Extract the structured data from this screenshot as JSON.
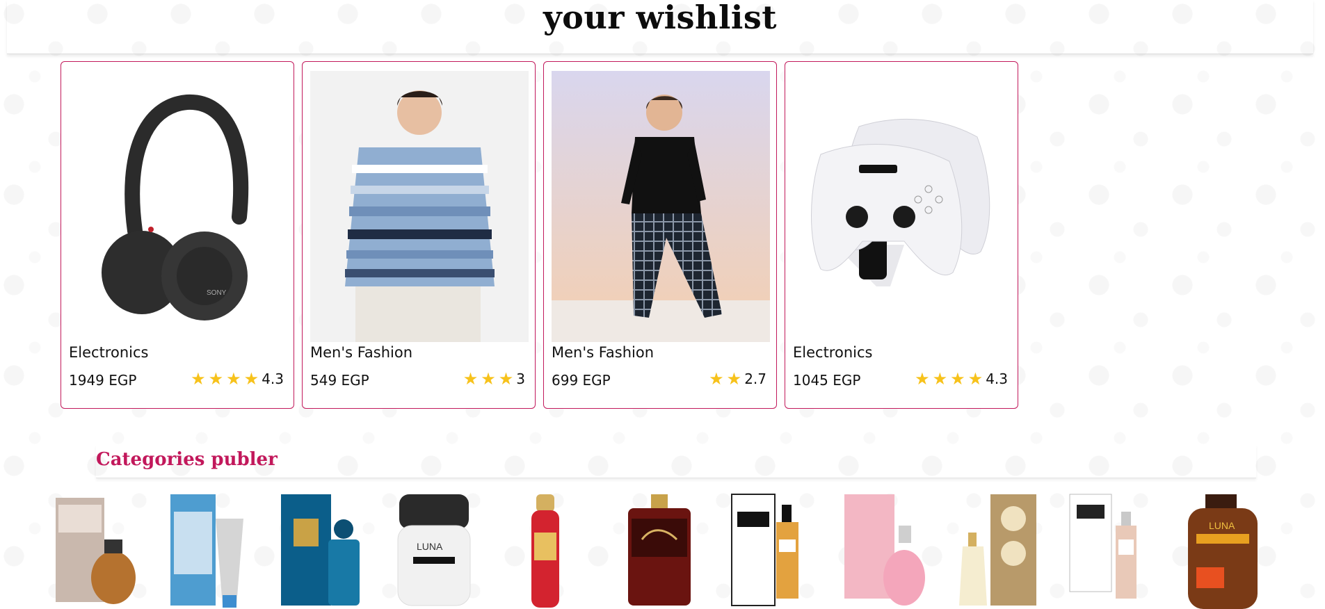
{
  "header": {
    "title": "your wishlist"
  },
  "wishlist": [
    {
      "category": "Electronics",
      "price": "1949 EGP",
      "stars": 4,
      "rating": "4.3",
      "image": "headphones-image"
    },
    {
      "category": "Men's Fashion",
      "price": "549 EGP",
      "stars": 3,
      "rating": "3",
      "image": "striped-sweater-image"
    },
    {
      "category": "Men's Fashion",
      "price": "699 EGP",
      "stars": 2,
      "rating": "2.7",
      "image": "pajama-set-image"
    },
    {
      "category": "Electronics",
      "price": "1045 EGP",
      "stars": 4,
      "rating": "4.3",
      "image": "controller-charger-image"
    }
  ],
  "categories": {
    "title": "Categories publer"
  },
  "colors": {
    "accent": "#c2185b",
    "star": "#f7c21b"
  }
}
